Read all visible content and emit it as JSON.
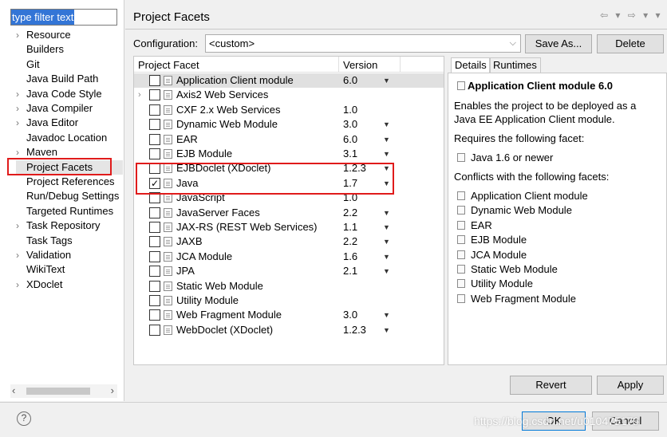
{
  "filter": {
    "value": "type filter text"
  },
  "tree": [
    {
      "label": "Resource",
      "expandable": true
    },
    {
      "label": "Builders",
      "expandable": false
    },
    {
      "label": "Git",
      "expandable": false
    },
    {
      "label": "Java Build Path",
      "expandable": false
    },
    {
      "label": "Java Code Style",
      "expandable": true
    },
    {
      "label": "Java Compiler",
      "expandable": true
    },
    {
      "label": "Java Editor",
      "expandable": true
    },
    {
      "label": "Javadoc Location",
      "expandable": false
    },
    {
      "label": "Maven",
      "expandable": true
    },
    {
      "label": "Project Facets",
      "expandable": false,
      "selected": true
    },
    {
      "label": "Project References",
      "expandable": false
    },
    {
      "label": "Run/Debug Settings",
      "expandable": false
    },
    {
      "label": "Targeted Runtimes",
      "expandable": false
    },
    {
      "label": "Task Repository",
      "expandable": true
    },
    {
      "label": "Task Tags",
      "expandable": false
    },
    {
      "label": "Validation",
      "expandable": true
    },
    {
      "label": "WikiText",
      "expandable": false
    },
    {
      "label": "XDoclet",
      "expandable": true
    }
  ],
  "header": {
    "title": "Project Facets",
    "nav": "⇦ ▾ ⇨ ▾ ▾"
  },
  "config": {
    "label": "Configuration:",
    "value": "<custom>",
    "save_as": "Save As...",
    "delete": "Delete"
  },
  "facets": {
    "col_facet": "Project Facet",
    "col_version": "Version",
    "rows": [
      {
        "name": "Application Client module",
        "version": "6.0",
        "dropdown": true,
        "checked": false,
        "selected": true
      },
      {
        "name": "Axis2 Web Services",
        "version": "",
        "dropdown": false,
        "checked": false,
        "expandable": true
      },
      {
        "name": "CXF 2.x Web Services",
        "version": "1.0",
        "dropdown": false,
        "checked": false
      },
      {
        "name": "Dynamic Web Module",
        "version": "3.0",
        "dropdown": true,
        "checked": false
      },
      {
        "name": "EAR",
        "version": "6.0",
        "dropdown": true,
        "checked": false
      },
      {
        "name": "EJB Module",
        "version": "3.1",
        "dropdown": true,
        "checked": false
      },
      {
        "name": "EJBDoclet (XDoclet)",
        "version": "1.2.3",
        "dropdown": true,
        "checked": false
      },
      {
        "name": "Java",
        "version": "1.7",
        "dropdown": true,
        "checked": true
      },
      {
        "name": "JavaScript",
        "version": "1.0",
        "dropdown": false,
        "checked": false
      },
      {
        "name": "JavaServer Faces",
        "version": "2.2",
        "dropdown": true,
        "checked": false
      },
      {
        "name": "JAX-RS (REST Web Services)",
        "version": "1.1",
        "dropdown": true,
        "checked": false
      },
      {
        "name": "JAXB",
        "version": "2.2",
        "dropdown": true,
        "checked": false
      },
      {
        "name": "JCA Module",
        "version": "1.6",
        "dropdown": true,
        "checked": false
      },
      {
        "name": "JPA",
        "version": "2.1",
        "dropdown": true,
        "checked": false
      },
      {
        "name": "Static Web Module",
        "version": "",
        "dropdown": false,
        "checked": false
      },
      {
        "name": "Utility Module",
        "version": "",
        "dropdown": false,
        "checked": false
      },
      {
        "name": "Web Fragment Module",
        "version": "3.0",
        "dropdown": true,
        "checked": false
      },
      {
        "name": "WebDoclet (XDoclet)",
        "version": "1.2.3",
        "dropdown": true,
        "checked": false
      }
    ]
  },
  "details": {
    "tab_details": "Details",
    "tab_runtimes": "Runtimes",
    "title": "Application Client module 6.0",
    "desc1": "Enables the project to be deployed as a",
    "desc2": "Java EE Application Client module.",
    "requires_label": "Requires the following facet:",
    "requires": [
      "Java 1.6 or newer"
    ],
    "conflicts_label": "Conflicts with the following facets:",
    "conflicts": [
      "Application Client module",
      "Dynamic Web Module",
      "EAR",
      "EJB Module",
      "JCA Module",
      "Static Web Module",
      "Utility Module",
      "Web Fragment Module"
    ]
  },
  "buttons": {
    "revert": "Revert",
    "apply": "Apply",
    "ok": "OK",
    "cancel": "Cancel"
  },
  "watermark": "https://blog.csdn.net/u010475179"
}
